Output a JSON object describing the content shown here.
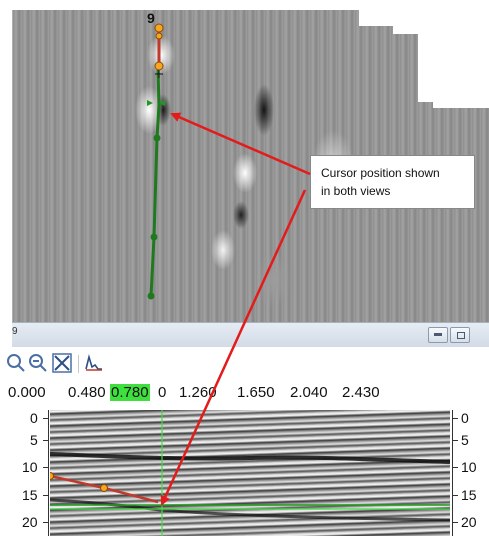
{
  "top_view": {
    "trace_number": "9"
  },
  "panel": {
    "title": "9",
    "minimize_icon": "minimize-icon",
    "restore_icon": "restore-icon"
  },
  "toolbar": {
    "icons": [
      "zoom-in-icon",
      "zoom-out-icon",
      "fit-extent-icon",
      "wavelet-icon"
    ]
  },
  "horizontal_axis": {
    "tick_labels": [
      "0.000",
      "0.480",
      "0.780",
      "0",
      "1.260",
      "1.650",
      "2.040",
      "2.430"
    ],
    "highlighted_value": "0.780"
  },
  "depth_axis": {
    "left_labels": [
      "0",
      "5",
      "10",
      "15",
      "20"
    ],
    "right_labels": [
      "0",
      "5",
      "10",
      "15",
      "20"
    ]
  },
  "annotation": {
    "text_line1": "Cursor position shown",
    "text_line2": "in both views"
  },
  "colors": {
    "trace_line": "#1f7a1f",
    "arrow": "#e31b1b",
    "pick_marker": "#f5a623",
    "cursor_highlight": "#3ee03e"
  }
}
